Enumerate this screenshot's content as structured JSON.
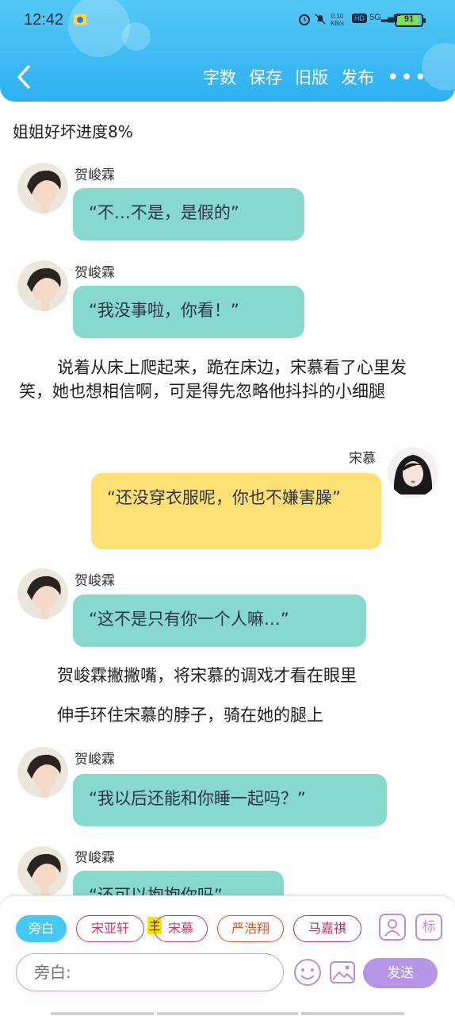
{
  "status_bar": {
    "time": "12:42",
    "net_speed_value": "0.10",
    "net_speed_unit": "KB/s",
    "hd_label": "HD",
    "signal_label": "5G",
    "battery": "91"
  },
  "toolbar": {
    "actions": [
      "字数",
      "保存",
      "旧版",
      "发布"
    ],
    "more": "•••"
  },
  "story_title": "姐姐好坏进度8%",
  "messages": [
    {
      "speaker": "贺峻霖",
      "text": "“不…不是，是假的”"
    },
    {
      "speaker": "贺峻霖",
      "text": "“我没事啦，你看！”"
    },
    {
      "narration": "说着从床上爬起来，跪在床边，宋慕看了心里发笑，她也想相信啊，可是得先忽略他抖抖的小细腿"
    },
    {
      "speaker": "宋慕",
      "text": "“还没穿衣服呢，你也不嫌害臊”"
    },
    {
      "speaker": "贺峻霖",
      "text": "“这不是只有你一个人嘛…”"
    },
    {
      "narration": "贺峻霖撇撇嘴，将宋慕的调戏才看在眼里"
    },
    {
      "narration": "伸手环住宋慕的脖子，骑在她的腿上"
    },
    {
      "speaker": "贺峻霖",
      "text": "“我以后还能和你睡一起吗？”"
    },
    {
      "speaker": "贺峻霖",
      "text": "“还可以抱抱你吗”"
    }
  ],
  "composer": {
    "roles": [
      "旁白",
      "宋亚轩",
      "宋慕",
      "严浩翔",
      "马嘉祺"
    ],
    "host_tag": "主",
    "mark_label": "标",
    "input_placeholder": "旁白:",
    "send_label": "发送"
  },
  "colors": {
    "header": "#2fb0f2",
    "bubble_male": "#87d8cd",
    "bubble_female": "#ffe074",
    "send": "#b595e6"
  }
}
